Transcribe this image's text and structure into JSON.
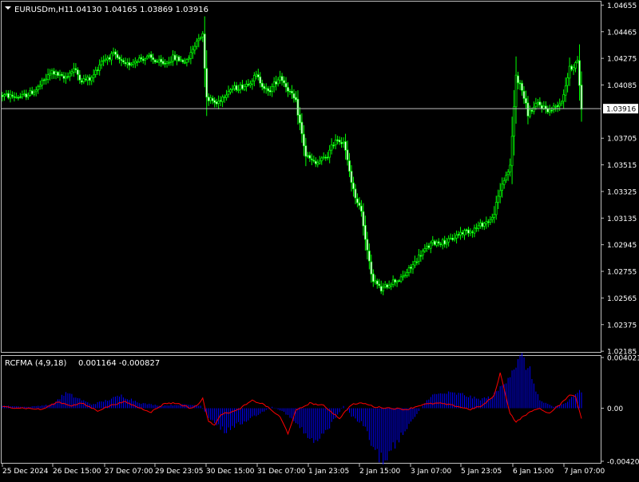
{
  "chart_data": [
    {
      "type": "candlestick",
      "header": {
        "symbol_label": "EURUSDm,H1",
        "ohlc_label": "1.04130 1.04165 1.03869 1.03916"
      },
      "current_price": 1.03916,
      "current_price_label": "1.03916",
      "ylim": [
        1.0218,
        1.0468
      ],
      "y_ticks": [
        1.04655,
        1.04465,
        1.04275,
        1.04085,
        1.03705,
        1.03515,
        1.03325,
        1.03135,
        1.02945,
        1.02755,
        1.02565,
        1.02375,
        1.02185
      ],
      "y_tick_labels": [
        "1.04655",
        "1.04465",
        "1.04275",
        "1.04085",
        "1.03705",
        "1.03515",
        "1.03325",
        "1.03135",
        "1.02945",
        "1.02755",
        "1.02565",
        "1.02375",
        "1.02185"
      ],
      "x_tick_labels": [
        "25 Dec 2024",
        "26 Dec 15:00",
        "27 Dec 07:00",
        "29 Dec 23:05",
        "30 Dec 15:00",
        "31 Dec 07:00",
        "1 Jan 23:05",
        "2 Jan 15:00",
        "3 Jan 07:00",
        "5 Jan 23:05",
        "6 Jan 15:00",
        "7 Jan 07:00"
      ],
      "close_anchors": [
        [
          0,
          1.0401
        ],
        [
          10,
          1.04
        ],
        [
          17,
          1.0405
        ],
        [
          25,
          1.0418
        ],
        [
          31,
          1.0413
        ],
        [
          36,
          1.042
        ],
        [
          40,
          1.0412
        ],
        [
          45,
          1.0413
        ],
        [
          50,
          1.0426
        ],
        [
          56,
          1.043
        ],
        [
          62,
          1.0422
        ],
        [
          68,
          1.0427
        ],
        [
          74,
          1.0428
        ],
        [
          81,
          1.0423
        ],
        [
          86,
          1.0428
        ],
        [
          93,
          1.0425
        ],
        [
          99,
          1.0443
        ],
        [
          101,
          1.0444
        ],
        [
          103,
          1.04
        ],
        [
          108,
          1.0395
        ],
        [
          114,
          1.0405
        ],
        [
          122,
          1.0408
        ],
        [
          128,
          1.0415
        ],
        [
          134,
          1.0403
        ],
        [
          140,
          1.0415
        ],
        [
          143,
          1.0408
        ],
        [
          148,
          1.0396
        ],
        [
          153,
          1.0358
        ],
        [
          158,
          1.0352
        ],
        [
          164,
          1.0358
        ],
        [
          168,
          1.037
        ],
        [
          172,
          1.0368
        ],
        [
          177,
          1.0333
        ],
        [
          181,
          1.0318
        ],
        [
          186,
          1.0272
        ],
        [
          191,
          1.0262
        ],
        [
          196,
          1.0268
        ],
        [
          201,
          1.027
        ],
        [
          206,
          1.0278
        ],
        [
          211,
          1.0288
        ],
        [
          217,
          1.0296
        ],
        [
          225,
          1.0297
        ],
        [
          231,
          1.0303
        ],
        [
          237,
          1.0305
        ],
        [
          243,
          1.031
        ],
        [
          247,
          1.0313
        ],
        [
          252,
          1.0338
        ],
        [
          256,
          1.035
        ],
        [
          259,
          1.0415
        ],
        [
          262,
          1.0405
        ],
        [
          265,
          1.0388
        ],
        [
          270,
          1.0395
        ],
        [
          276,
          1.039
        ],
        [
          282,
          1.0397
        ],
        [
          286,
          1.042
        ],
        [
          290,
          1.0425
        ],
        [
          292,
          1.0392
        ]
      ]
    },
    {
      "type": "histogram_line",
      "header": {
        "name_label": "RCFMA (4,9,18)",
        "values_label": "0.001164 -0.000827"
      },
      "ylim": [
        -0.004207,
        0.004021
      ],
      "y_ticks": [
        0.004021,
        0.0,
        -0.004207
      ],
      "y_tick_labels": [
        "0.004021",
        "0.00",
        "-0.004207"
      ],
      "hist_color": "#0000ff",
      "line_color": "#ff0000",
      "hist_anchors": [
        [
          0,
          0.0002
        ],
        [
          13,
          0.0001
        ],
        [
          25,
          0.0003
        ],
        [
          32,
          0.0012
        ],
        [
          38,
          0.0008
        ],
        [
          45,
          0.0003
        ],
        [
          52,
          0.0006
        ],
        [
          60,
          0.001
        ],
        [
          70,
          0.0004
        ],
        [
          80,
          0.0002
        ],
        [
          92,
          0.0003
        ],
        [
          100,
          0.0002
        ],
        [
          104,
          -0.0008
        ],
        [
          112,
          -0.0018
        ],
        [
          120,
          -0.0012
        ],
        [
          130,
          -0.0004
        ],
        [
          136,
          0.0001
        ],
        [
          142,
          -0.0003
        ],
        [
          150,
          -0.0015
        ],
        [
          156,
          -0.0027
        ],
        [
          160,
          -0.0025
        ],
        [
          166,
          -0.0012
        ],
        [
          172,
          0.0002
        ],
        [
          176,
          -0.0006
        ],
        [
          182,
          -0.0013
        ],
        [
          187,
          -0.0032
        ],
        [
          192,
          -0.0041
        ],
        [
          198,
          -0.003
        ],
        [
          204,
          -0.0015
        ],
        [
          210,
          -0.0002
        ],
        [
          216,
          0.001
        ],
        [
          224,
          0.0012
        ],
        [
          232,
          0.0011
        ],
        [
          240,
          0.0007
        ],
        [
          247,
          0.0009
        ],
        [
          252,
          0.0018
        ],
        [
          258,
          0.0033
        ],
        [
          262,
          0.004
        ],
        [
          266,
          0.0029
        ],
        [
          271,
          0.0006
        ],
        [
          278,
          0.0001
        ],
        [
          284,
          0.0004
        ],
        [
          290,
          0.0013
        ],
        [
          292,
          0.0013
        ]
      ],
      "line_anchors": [
        [
          0,
          0.0001
        ],
        [
          12,
          0.0
        ],
        [
          20,
          -0.0001
        ],
        [
          28,
          0.0005
        ],
        [
          35,
          0.0002
        ],
        [
          40,
          0.0004
        ],
        [
          48,
          -0.0002
        ],
        [
          56,
          0.0003
        ],
        [
          62,
          0.0005
        ],
        [
          68,
          0.0001
        ],
        [
          75,
          -0.0003
        ],
        [
          82,
          0.0004
        ],
        [
          88,
          0.0004
        ],
        [
          95,
          0.0
        ],
        [
          99,
          0.0003
        ],
        [
          101,
          0.0008
        ],
        [
          104,
          -0.0011
        ],
        [
          107,
          -0.0013
        ],
        [
          110,
          -0.0005
        ],
        [
          118,
          -0.0002
        ],
        [
          126,
          0.0006
        ],
        [
          132,
          0.0003
        ],
        [
          140,
          -0.0007
        ],
        [
          144,
          -0.002
        ],
        [
          148,
          -0.0002
        ],
        [
          155,
          0.0004
        ],
        [
          162,
          0.0002
        ],
        [
          170,
          -0.0008
        ],
        [
          176,
          0.0003
        ],
        [
          182,
          0.0004
        ],
        [
          188,
          0.0001
        ],
        [
          196,
          0.0
        ],
        [
          204,
          -0.0001
        ],
        [
          212,
          0.0003
        ],
        [
          220,
          0.0004
        ],
        [
          228,
          0.0002
        ],
        [
          236,
          -0.0001
        ],
        [
          242,
          0.0002
        ],
        [
          248,
          0.001
        ],
        [
          251,
          0.0028
        ],
        [
          253,
          0.0015
        ],
        [
          256,
          -0.0004
        ],
        [
          259,
          -0.0011
        ],
        [
          264,
          -0.0005
        ],
        [
          270,
          0.0
        ],
        [
          276,
          -0.0004
        ],
        [
          282,
          0.0004
        ],
        [
          286,
          0.0011
        ],
        [
          289,
          0.0009
        ],
        [
          292,
          -0.0008
        ]
      ]
    }
  ]
}
